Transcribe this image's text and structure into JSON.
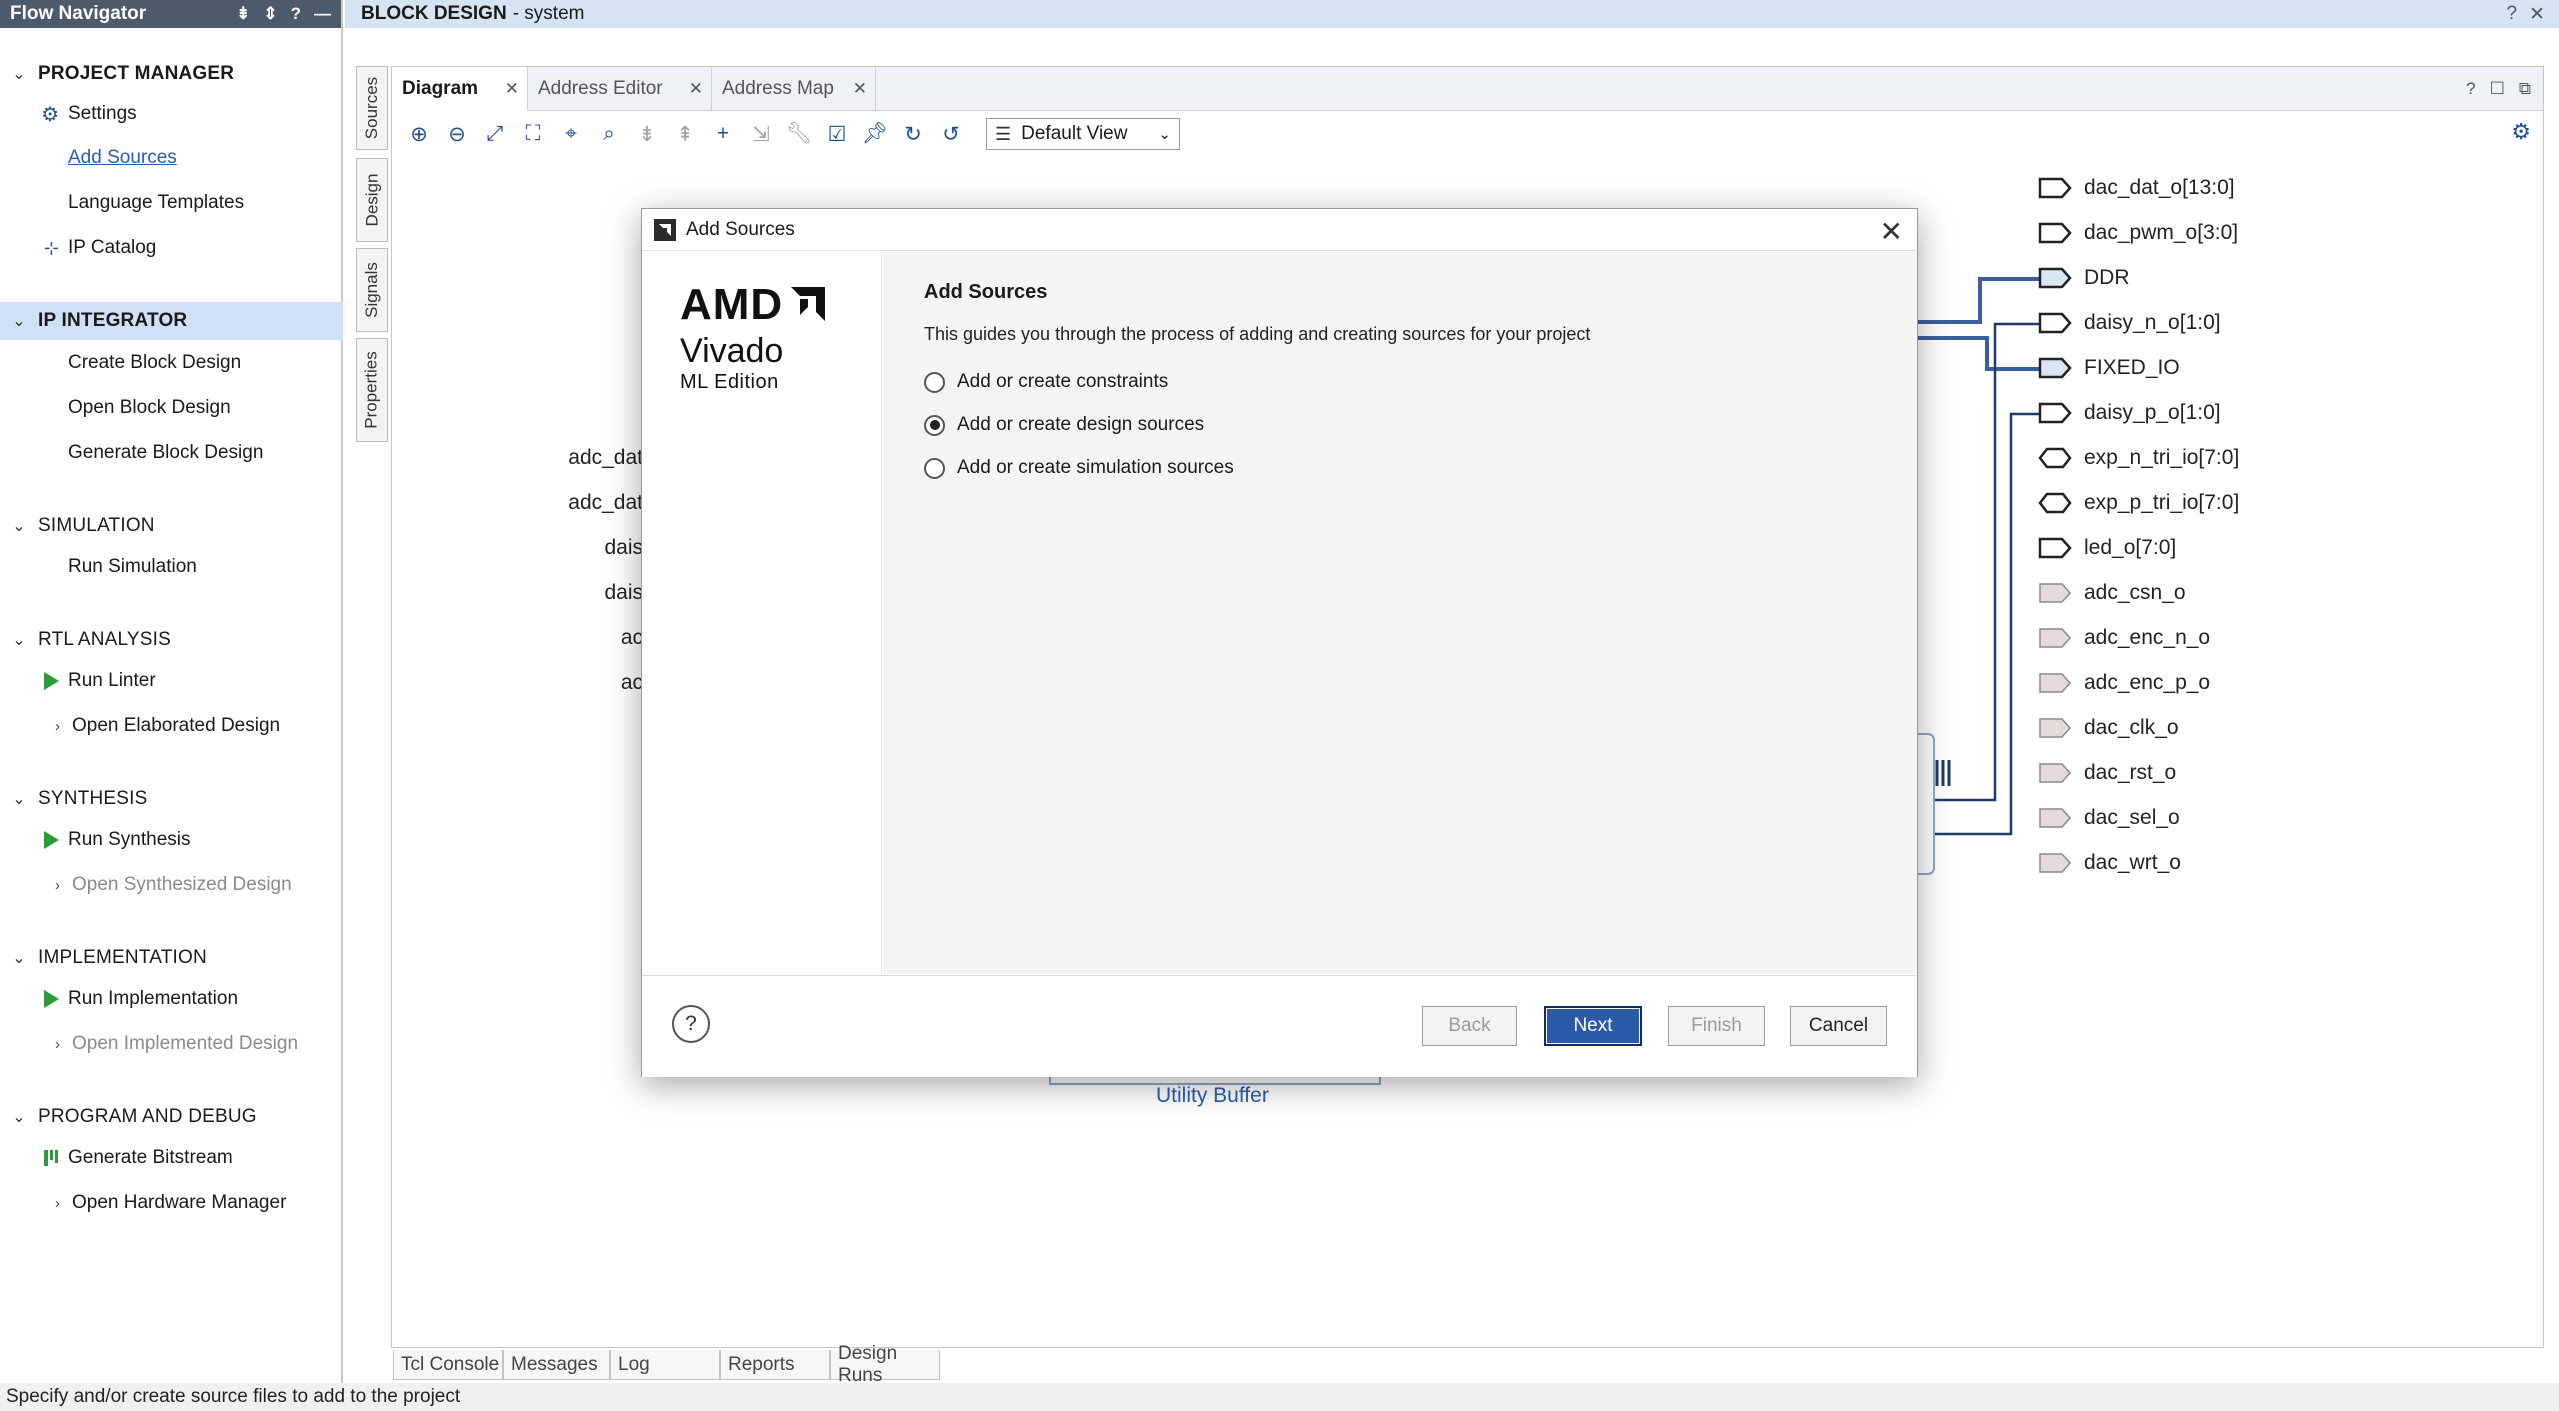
{
  "flow_navigator": {
    "title": "Flow Navigator",
    "sections": [
      {
        "label": "PROJECT MANAGER",
        "items": [
          {
            "label": "Settings",
            "icon": "gear-icon"
          },
          {
            "label": "Add Sources"
          },
          {
            "label": "Language Templates"
          },
          {
            "label": "IP Catalog",
            "icon": "ip-catalog-icon"
          }
        ]
      },
      {
        "label": "IP INTEGRATOR",
        "items": [
          {
            "label": "Create Block Design"
          },
          {
            "label": "Open Block Design"
          },
          {
            "label": "Generate Block Design"
          }
        ]
      },
      {
        "label": "SIMULATION",
        "items": [
          {
            "label": "Run Simulation"
          }
        ]
      },
      {
        "label": "RTL ANALYSIS",
        "items": [
          {
            "label": "Run Linter",
            "icon": "run-icon"
          },
          {
            "label": "Open Elaborated Design"
          }
        ]
      },
      {
        "label": "SYNTHESIS",
        "items": [
          {
            "label": "Run Synthesis",
            "icon": "run-icon"
          },
          {
            "label": "Open Synthesized Design"
          }
        ]
      },
      {
        "label": "IMPLEMENTATION",
        "items": [
          {
            "label": "Run Implementation",
            "icon": "run-icon"
          },
          {
            "label": "Open Implemented Design"
          }
        ]
      },
      {
        "label": "PROGRAM AND DEBUG",
        "items": [
          {
            "label": "Generate Bitstream",
            "icon": "bitstream-icon"
          },
          {
            "label": "Open Hardware Manager"
          }
        ]
      }
    ]
  },
  "block_design": {
    "title_prefix": "BLOCK DESIGN",
    "title_suffix": "- system"
  },
  "side_tabs": [
    "Sources",
    "Design",
    "Signals",
    "Properties"
  ],
  "doc_tabs": [
    "Diagram",
    "Address Editor",
    "Address Map"
  ],
  "toolbar": {
    "view_select": "Default View"
  },
  "canvas": {
    "left_labels": [
      "adc_dat",
      "adc_dat",
      "dais",
      "dais",
      "ac",
      "ac"
    ],
    "ports": [
      "dac_dat_o[13:0]",
      "dac_pwm_o[3:0]",
      "DDR",
      "daisy_n_o[1:0]",
      "FIXED_IO",
      "daisy_p_o[1:0]",
      "exp_n_tri_io[7:0]",
      "exp_p_tri_io[7:0]",
      "led_o[7:0]",
      "adc_csn_o",
      "adc_enc_n_o",
      "adc_enc_p_o",
      "dac_clk_o",
      "dac_rst_o",
      "dac_sel_o",
      "dac_wrt_o"
    ],
    "utility_buffer": "Utility Buffer"
  },
  "dialog": {
    "title": "Add Sources",
    "logo": {
      "brand": "AMD",
      "product": "Vivado",
      "edition": "ML Edition"
    },
    "heading": "Add Sources",
    "description": "This guides you through the process of adding and creating sources for your project",
    "options": [
      {
        "label": "Add or create constraints",
        "checked": false
      },
      {
        "label": "Add or create design sources",
        "checked": true
      },
      {
        "label": "Add or create simulation sources",
        "checked": false
      }
    ],
    "buttons": {
      "help": "?",
      "back": "Back",
      "next": "Next",
      "finish": "Finish",
      "cancel": "Cancel"
    }
  },
  "bottom_tabs": [
    "Tcl Console",
    "Messages",
    "Log",
    "Reports",
    "Design Runs"
  ],
  "status_bar": "Specify and/or create source files to add to the project",
  "colors": {
    "accent": "#2b5aa8",
    "nav_header": "#4d5a6b",
    "run_green": "#2e9a3a",
    "wire_blue": "#3a5f9e"
  }
}
